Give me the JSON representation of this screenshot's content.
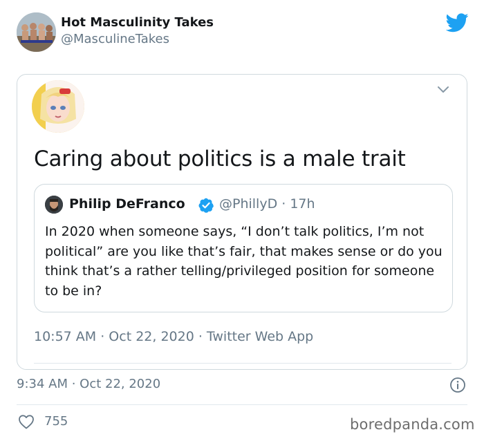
{
  "outer_tweet": {
    "display_name": "Hot Masculinity Takes",
    "handle": "@MasculineTakes",
    "timestamp": "9:34 AM · Oct 22, 2020",
    "like_count": "755",
    "brand_color": "#1da1f2"
  },
  "embedded_tweet": {
    "text": "Caring about politics is a male trait",
    "meta": "10:57 AM · Oct 22, 2020 · Twitter Web App"
  },
  "quoted_tweet": {
    "display_name": "Philip DeFranco",
    "handle_time": "@PhillyD · 17h",
    "body": "In 2020 when someone says, “I don’t talk politics, I’m not political” are you like that’s fair, that makes sense or do you think that’s a rather telling/privileged position for someone to be in?",
    "verified_color": "#1da1f2"
  },
  "icons": [
    "twitter-bird-icon",
    "chevron-down-icon",
    "verified-badge-icon",
    "info-icon",
    "heart-icon"
  ],
  "watermark": "boredpanda.com"
}
